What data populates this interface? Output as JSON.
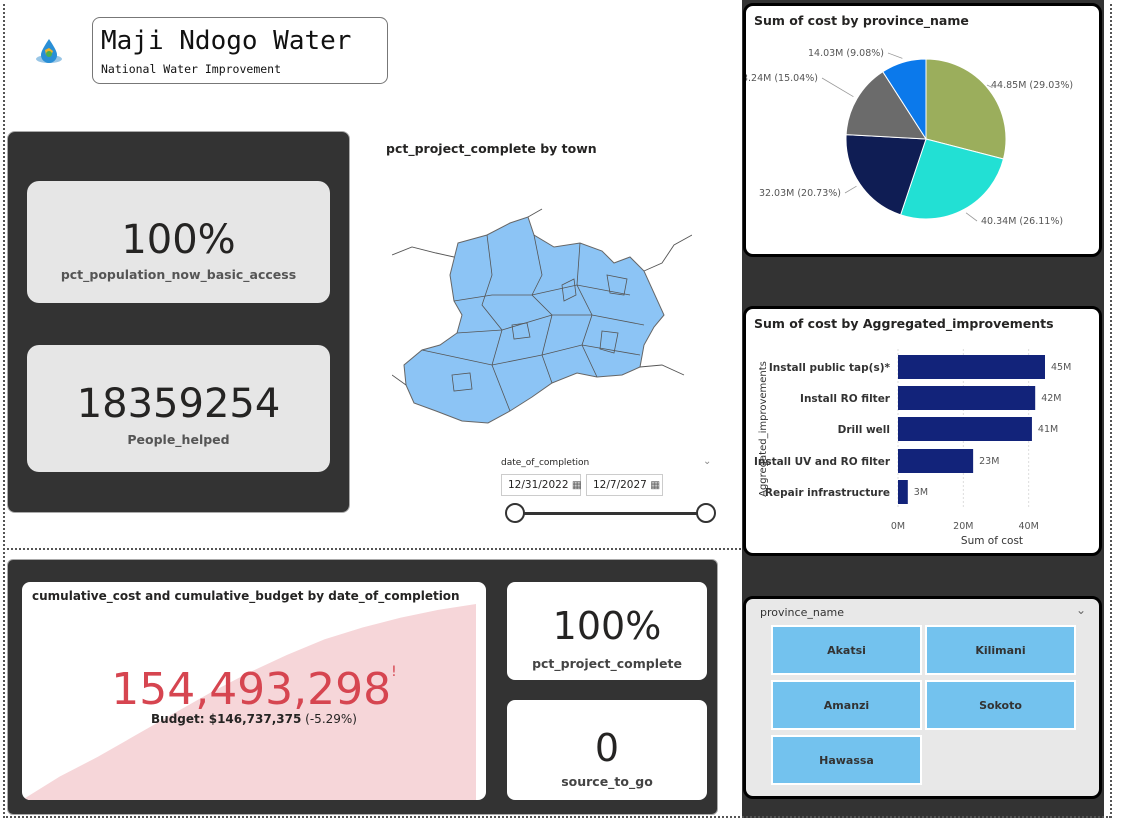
{
  "header": {
    "title": "Maji Ndogo Water",
    "subtitle": "National Water Improvement",
    "logo_icon": "water-drop-globe-icon"
  },
  "kpis": {
    "basic_access": {
      "value": "100%",
      "label": "pct_population_now_basic_access"
    },
    "people_helped": {
      "value": "18359254",
      "label": "People_helped"
    },
    "project_complete": {
      "value": "100%",
      "label": "pct_project_complete"
    },
    "source_to_go": {
      "value": "0",
      "label": "source_to_go"
    }
  },
  "map": {
    "title": "pct_project_complete by town",
    "fill_color": "#8cc4f5"
  },
  "date_slicer": {
    "label": "date_of_completion",
    "start": "12/31/2022",
    "end": "12/7/2027",
    "calendar_icon": "calendar-icon",
    "chevron_icon": "chevron-down-icon"
  },
  "cumulative": {
    "title": "cumulative_cost and cumulative_budget by date_of_completion",
    "value": "154,493,298",
    "marker": "!",
    "budget_label": "Budget: $146,737,375",
    "budget_variance": "(-5.29%)",
    "value_color": "#d64550",
    "area_color": "#f6d6d9",
    "area_data": [
      0,
      0.12,
      0.22,
      0.33,
      0.44,
      0.55,
      0.65,
      0.74,
      0.82,
      0.88,
      0.93,
      0.97,
      1.0
    ]
  },
  "province_slicer": {
    "label": "province_name",
    "chevron_icon": "chevron-down-icon",
    "options": [
      "Akatsi",
      "Kilimani",
      "Amanzi",
      "Sokoto",
      "Hawassa"
    ]
  },
  "chart_data": [
    {
      "type": "pie",
      "title": "Sum of cost by province_name",
      "slices": [
        {
          "label": "44.85M (29.03%)",
          "value": 44.85,
          "color": "#9bae5c"
        },
        {
          "label": "40.34M (26.11%)",
          "value": 40.34,
          "color": "#22e0d4"
        },
        {
          "label": "32.03M (20.73%)",
          "value": 32.03,
          "color": "#0f1d54"
        },
        {
          "label": "23.24M (15.04%)",
          "value": 23.24,
          "color": "#6b6b6b"
        },
        {
          "label": "14.03M (9.08%)",
          "value": 14.03,
          "color": "#0b79eb"
        }
      ]
    },
    {
      "type": "bar",
      "orientation": "horizontal",
      "title": "Sum of cost by Aggregated_improvements",
      "xlabel": "Sum of cost",
      "ylabel": "Aggregated_improvements",
      "categories": [
        "Install public tap(s)*",
        "Install RO filter",
        "Drill well",
        "Install UV and RO filter",
        "Repair infrastructure"
      ],
      "values": [
        45,
        42,
        41,
        23,
        3
      ],
      "value_labels": [
        "45M",
        "42M",
        "41M",
        "23M",
        "3M"
      ],
      "xticks": [
        "0M",
        "20M",
        "40M"
      ],
      "xlim": [
        0,
        45
      ],
      "bar_color": "#12237a"
    }
  ]
}
